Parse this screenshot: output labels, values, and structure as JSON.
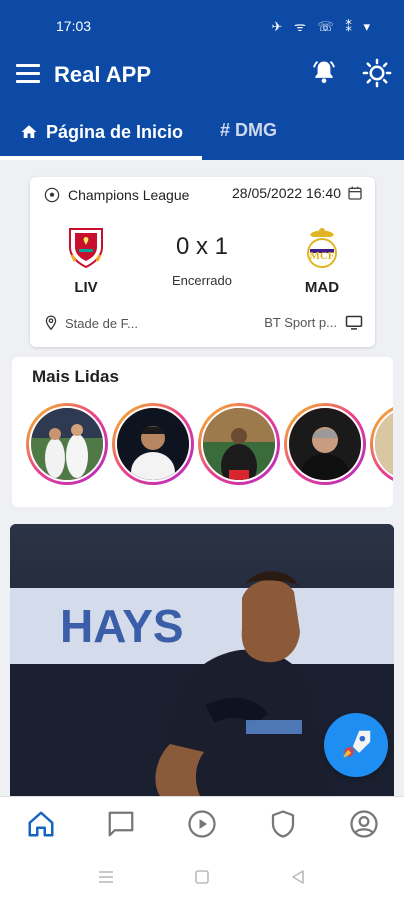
{
  "status_bar": {
    "time": "17:03",
    "icons": "✈ ᯤ ☏ ⁑ ▾"
  },
  "app_bar": {
    "title": "Real APP"
  },
  "tabs": [
    {
      "label": "Página de Inicio",
      "active": true
    },
    {
      "label": "# DMG",
      "active": false
    }
  ],
  "match": {
    "competition": "Champions League",
    "datetime": "28/05/2022 16:40",
    "home_team": "LIV",
    "away_team": "MAD",
    "score": "0 x 1",
    "status": "Encerrado",
    "venue": "Stade de F...",
    "broadcaster": "BT Sport p..."
  },
  "most_read": {
    "title": "Mais Lidas"
  },
  "colors": {
    "primary": "#0c4aa6",
    "accent": "#1f8ef2",
    "nav_active": "#1565c0"
  },
  "bottom_nav": [
    {
      "icon": "home-icon",
      "active": true
    },
    {
      "icon": "chat-icon",
      "active": false
    },
    {
      "icon": "play-icon",
      "active": false
    },
    {
      "icon": "shield-icon",
      "active": false
    },
    {
      "icon": "profile-icon",
      "active": false
    }
  ]
}
